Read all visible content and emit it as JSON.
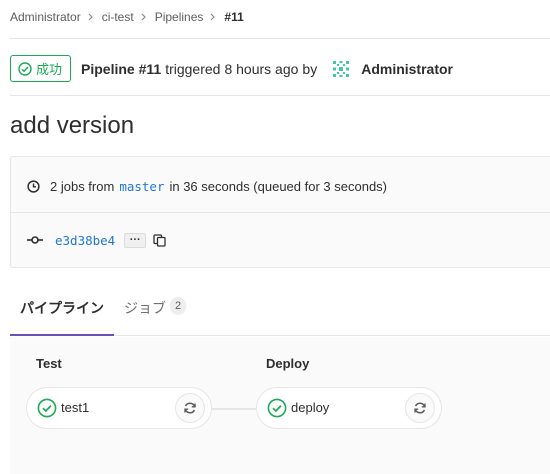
{
  "breadcrumb": {
    "items": [
      {
        "label": "Administrator"
      },
      {
        "label": "ci-test"
      },
      {
        "label": "Pipelines"
      },
      {
        "label": "#11"
      }
    ]
  },
  "header": {
    "status_label": "成功",
    "pipeline_label": "Pipeline #11",
    "triggered_text": "triggered",
    "time_ago": "8 hours ago",
    "by_text": "by",
    "user_name": "Administrator"
  },
  "title": "add version",
  "info": {
    "jobs_count_text": "2 jobs from",
    "branch": "master",
    "duration_text": "in 36 seconds (queued for 3 seconds)",
    "commit_sha": "e3d38be4",
    "ellipsis": "···"
  },
  "tabs": [
    {
      "label": "パイプライン",
      "active": true
    },
    {
      "label": "ジョブ",
      "count": "2",
      "active": false
    }
  ],
  "pipeline_graph": {
    "stages": [
      {
        "title": "Test",
        "jobs": [
          {
            "name": "test1",
            "status": "success"
          }
        ]
      },
      {
        "title": "Deploy",
        "jobs": [
          {
            "name": "deploy",
            "status": "success"
          }
        ]
      }
    ]
  },
  "colors": {
    "success": "#1aaa55",
    "link": "#1f78d1",
    "active_tab": "#6b4fbb",
    "border": "#e5e5e5"
  },
  "icons": {
    "status": "status-success-icon",
    "clock": "clock-icon",
    "commit": "commit-icon",
    "copy": "copy-icon",
    "retry": "retry-icon",
    "breadcrumb_separator": "chevron-right-icon",
    "avatar": "identicon-avatar"
  }
}
